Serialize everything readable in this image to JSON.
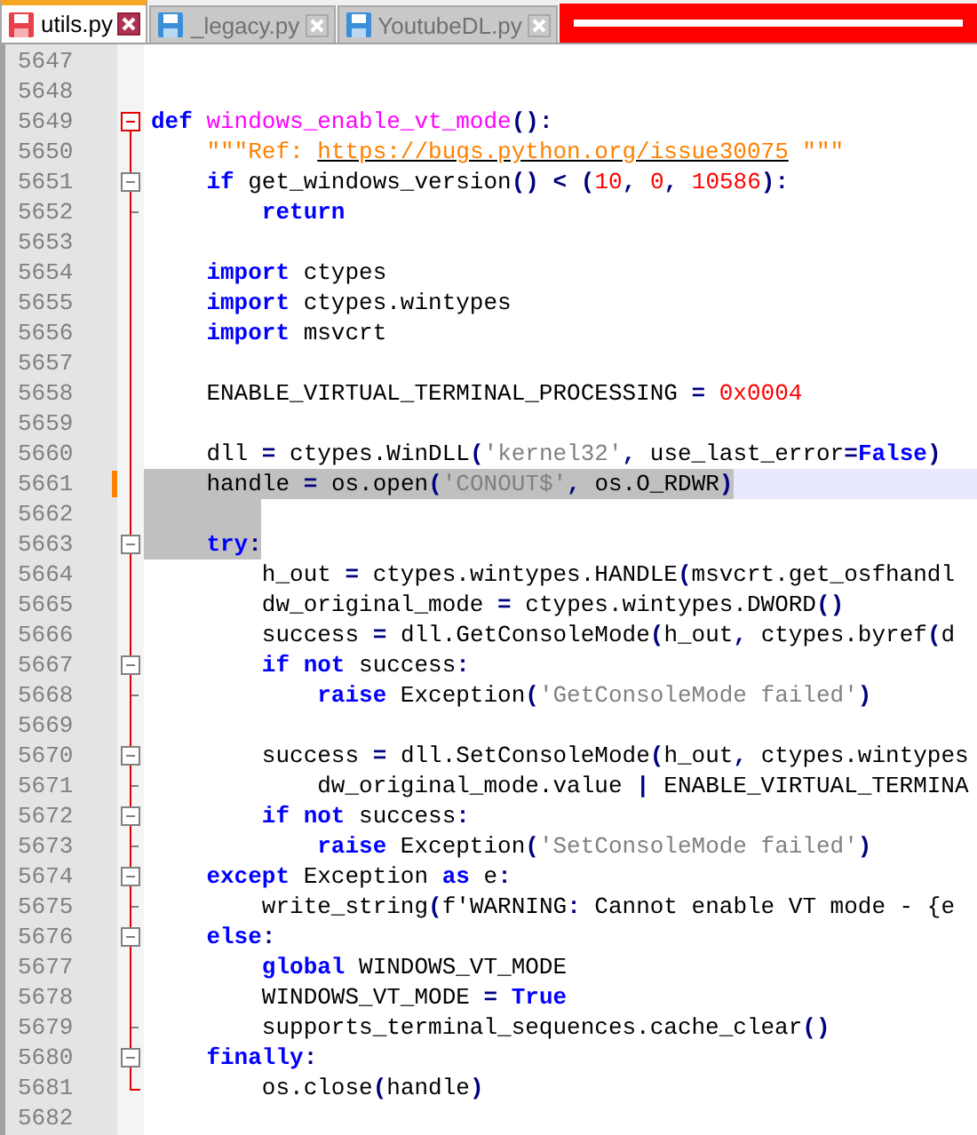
{
  "tabs": [
    {
      "label": "utils.py",
      "selected": true
    },
    {
      "label": "_legacy.py",
      "selected": false
    },
    {
      "label": "YoutubeDL.py",
      "selected": false
    }
  ],
  "editor": {
    "lines": [
      {
        "number": "5647",
        "selected": false,
        "current": false,
        "changed": false
      },
      {
        "number": "5648",
        "selected": false,
        "current": false,
        "changed": false
      },
      {
        "number": "5649",
        "fold": {
          "kind": "head"
        },
        "selected": false,
        "current": false,
        "changed": false,
        "tokens": [
          {
            "kind": "kw",
            "text": "def"
          },
          {
            "kind": "fn",
            "text": " windows_enable_vt_mode"
          },
          {
            "kind": "plain",
            "text": "():"
          }
        ]
      },
      {
        "number": "5650",
        "fold": {
          "kind": "line"
        },
        "selected": false,
        "current": false,
        "changed": false,
        "tokens": [
          {
            "kind": "doc",
            "text": "    \"\"\"Ref: "
          },
          {
            "kind": "link",
            "text": "https://bugs.python.org/issue30075"
          },
          {
            "kind": "doc",
            "text": " \"\"\""
          }
        ]
      },
      {
        "number": "5651",
        "fold": {
          "kind": "open"
        },
        "selected": false,
        "current": false,
        "changed": false,
        "tokens": [
          {
            "kind": "kw",
            "text": "    if"
          },
          {
            "kind": "plain",
            "text": " get_windows_version() < ("
          },
          {
            "kind": "num",
            "text": "10"
          },
          {
            "kind": "plain",
            "text": ", "
          },
          {
            "kind": "num",
            "text": "0"
          },
          {
            "kind": "plain",
            "text": ", "
          },
          {
            "kind": "num",
            "text": "10586"
          },
          {
            "kind": "plain",
            "text": "):"
          }
        ]
      },
      {
        "number": "5652",
        "fold": {
          "kind": "end"
        },
        "selected": false,
        "current": false,
        "changed": false,
        "tokens": [
          {
            "kind": "kw",
            "text": "        return"
          }
        ]
      },
      {
        "number": "5653",
        "fold": {
          "kind": "line"
        },
        "selected": false,
        "current": false,
        "changed": false
      },
      {
        "number": "5654",
        "fold": {
          "kind": "line"
        },
        "selected": false,
        "current": false,
        "changed": false,
        "tokens": [
          {
            "kind": "kw",
            "text": "    import"
          },
          {
            "kind": "plain",
            "text": " ctypes"
          }
        ]
      },
      {
        "number": "5655",
        "fold": {
          "kind": "line"
        },
        "selected": false,
        "current": false,
        "changed": false,
        "tokens": [
          {
            "kind": "kw",
            "text": "    import"
          },
          {
            "kind": "plain",
            "text": " ctypes.wintypes"
          }
        ]
      },
      {
        "number": "5656",
        "fold": {
          "kind": "line"
        },
        "selected": false,
        "current": false,
        "changed": false,
        "tokens": [
          {
            "kind": "kw",
            "text": "    import"
          },
          {
            "kind": "plain",
            "text": " msvcrt"
          }
        ]
      },
      {
        "number": "5657",
        "fold": {
          "kind": "line"
        },
        "selected": false,
        "current": false,
        "changed": false
      },
      {
        "number": "5658",
        "fold": {
          "kind": "line"
        },
        "selected": false,
        "current": false,
        "changed": false,
        "tokens": [
          {
            "kind": "plain",
            "text": "    ENABLE_VIRTUAL_TERMINAL_PROCESSING = "
          },
          {
            "kind": "num",
            "text": "0x0004"
          }
        ]
      },
      {
        "number": "5659",
        "fold": {
          "kind": "line"
        },
        "selected": false,
        "current": false,
        "changed": false
      },
      {
        "number": "5660",
        "fold": {
          "kind": "line"
        },
        "selected": false,
        "current": false,
        "changed": false,
        "tokens": [
          {
            "kind": "plain",
            "text": "    dll = ctypes.WinDLL("
          },
          {
            "kind": "str",
            "text": "'kernel32'"
          },
          {
            "kind": "plain",
            "text": ", use_last_error="
          },
          {
            "kind": "kw",
            "text": "False"
          },
          {
            "kind": "plain",
            "text": ")"
          }
        ]
      },
      {
        "number": "5661",
        "fold": {
          "kind": "line"
        },
        "selected": true,
        "current": true,
        "changed": true,
        "tokens": [
          {
            "kind": "plain",
            "text": "    handle = os.open("
          },
          {
            "kind": "str",
            "text": "'CONOUT$'"
          },
          {
            "kind": "plain",
            "text": ", os.O_RDWR)"
          }
        ]
      },
      {
        "number": "5662",
        "fold": {
          "kind": "line"
        },
        "selected": true,
        "current": false,
        "changed": false
      },
      {
        "number": "5663",
        "fold": {
          "kind": "open"
        },
        "selected": true,
        "current": false,
        "changed": false,
        "tokens": [
          {
            "kind": "kw",
            "text": "    try"
          },
          {
            "kind": "plain",
            "text": ":"
          }
        ]
      },
      {
        "number": "5664",
        "fold": {
          "kind": "line"
        },
        "selected": false,
        "current": false,
        "changed": false,
        "tokens": [
          {
            "kind": "plain",
            "text": "        h_out = ctypes.wintypes.HANDLE(msvcrt.get_osfhandl"
          }
        ]
      },
      {
        "number": "5665",
        "fold": {
          "kind": "line"
        },
        "selected": false,
        "current": false,
        "changed": false,
        "tokens": [
          {
            "kind": "plain",
            "text": "        dw_original_mode = ctypes.wintypes.DWORD()"
          }
        ]
      },
      {
        "number": "5666",
        "fold": {
          "kind": "line"
        },
        "selected": false,
        "current": false,
        "changed": false,
        "tokens": [
          {
            "kind": "plain",
            "text": "        success = dll.GetConsoleMode(h_out, ctypes.byref(d"
          }
        ]
      },
      {
        "number": "5667",
        "fold": {
          "kind": "open"
        },
        "selected": false,
        "current": false,
        "changed": false,
        "tokens": [
          {
            "kind": "kw",
            "text": "        if not"
          },
          {
            "kind": "plain",
            "text": " success:"
          }
        ]
      },
      {
        "number": "5668",
        "fold": {
          "kind": "end"
        },
        "selected": false,
        "current": false,
        "changed": false,
        "tokens": [
          {
            "kind": "kw",
            "text": "            raise"
          },
          {
            "kind": "plain",
            "text": " Exception("
          },
          {
            "kind": "str",
            "text": "'GetConsoleMode failed'"
          },
          {
            "kind": "plain",
            "text": ")"
          }
        ]
      },
      {
        "number": "5669",
        "fold": {
          "kind": "line"
        },
        "selected": false,
        "current": false,
        "changed": false
      },
      {
        "number": "5670",
        "fold": {
          "kind": "open"
        },
        "selected": false,
        "current": false,
        "changed": false,
        "tokens": [
          {
            "kind": "plain",
            "text": "        success = dll.SetConsoleMode(h_out, ctypes.wintypes"
          }
        ]
      },
      {
        "number": "5671",
        "fold": {
          "kind": "end"
        },
        "selected": false,
        "current": false,
        "changed": false,
        "tokens": [
          {
            "kind": "plain",
            "text": "            dw_original_mode.value | ENABLE_VIRTUAL_TERMINA"
          }
        ]
      },
      {
        "number": "5672",
        "fold": {
          "kind": "open"
        },
        "selected": false,
        "current": false,
        "changed": false,
        "tokens": [
          {
            "kind": "kw",
            "text": "        if not"
          },
          {
            "kind": "plain",
            "text": " success:"
          }
        ]
      },
      {
        "number": "5673",
        "fold": {
          "kind": "end"
        },
        "selected": false,
        "current": false,
        "changed": false,
        "tokens": [
          {
            "kind": "kw",
            "text": "            raise"
          },
          {
            "kind": "plain",
            "text": " Exception("
          },
          {
            "kind": "str",
            "text": "'SetConsoleMode failed'"
          },
          {
            "kind": "plain",
            "text": ")"
          }
        ]
      },
      {
        "number": "5674",
        "fold": {
          "kind": "open"
        },
        "selected": false,
        "current": false,
        "changed": false,
        "tokens": [
          {
            "kind": "kw",
            "text": "    except"
          },
          {
            "kind": "plain",
            "text": " Exception "
          },
          {
            "kind": "kw",
            "text": "as"
          },
          {
            "kind": "plain",
            "text": " e:"
          }
        ]
      },
      {
        "number": "5675",
        "fold": {
          "kind": "end"
        },
        "selected": false,
        "current": false,
        "changed": false,
        "tokens": [
          {
            "kind": "plain",
            "text": "        write_string(f'WARNING: Cannot enable VT mode - {e"
          }
        ]
      },
      {
        "number": "5676",
        "fold": {
          "kind": "open"
        },
        "selected": false,
        "current": false,
        "changed": false,
        "tokens": [
          {
            "kind": "kw",
            "text": "    else"
          },
          {
            "kind": "plain",
            "text": ":"
          }
        ]
      },
      {
        "number": "5677",
        "fold": {
          "kind": "line"
        },
        "selected": false,
        "current": false,
        "changed": false,
        "tokens": [
          {
            "kind": "kw",
            "text": "        global"
          },
          {
            "kind": "plain",
            "text": " WINDOWS_VT_MODE"
          }
        ]
      },
      {
        "number": "5678",
        "fold": {
          "kind": "line"
        },
        "selected": false,
        "current": false,
        "changed": false,
        "tokens": [
          {
            "kind": "plain",
            "text": "        WINDOWS_VT_MODE = "
          },
          {
            "kind": "kw",
            "text": "True"
          }
        ]
      },
      {
        "number": "5679",
        "fold": {
          "kind": "end"
        },
        "selected": false,
        "current": false,
        "changed": false,
        "tokens": [
          {
            "kind": "plain",
            "text": "        supports_terminal_sequences.cache_clear()"
          }
        ]
      },
      {
        "number": "5680",
        "fold": {
          "kind": "open"
        },
        "selected": false,
        "current": false,
        "changed": false,
        "tokens": [
          {
            "kind": "kw",
            "text": "    finally"
          },
          {
            "kind": "plain",
            "text": ":"
          }
        ]
      },
      {
        "number": "5681",
        "fold": {
          "kind": "last"
        },
        "selected": false,
        "current": false,
        "changed": false,
        "tokens": [
          {
            "kind": "plain",
            "text": "        os.close(handle)"
          }
        ]
      },
      {
        "number": "5682",
        "selected": false,
        "current": false,
        "changed": false
      }
    ]
  }
}
